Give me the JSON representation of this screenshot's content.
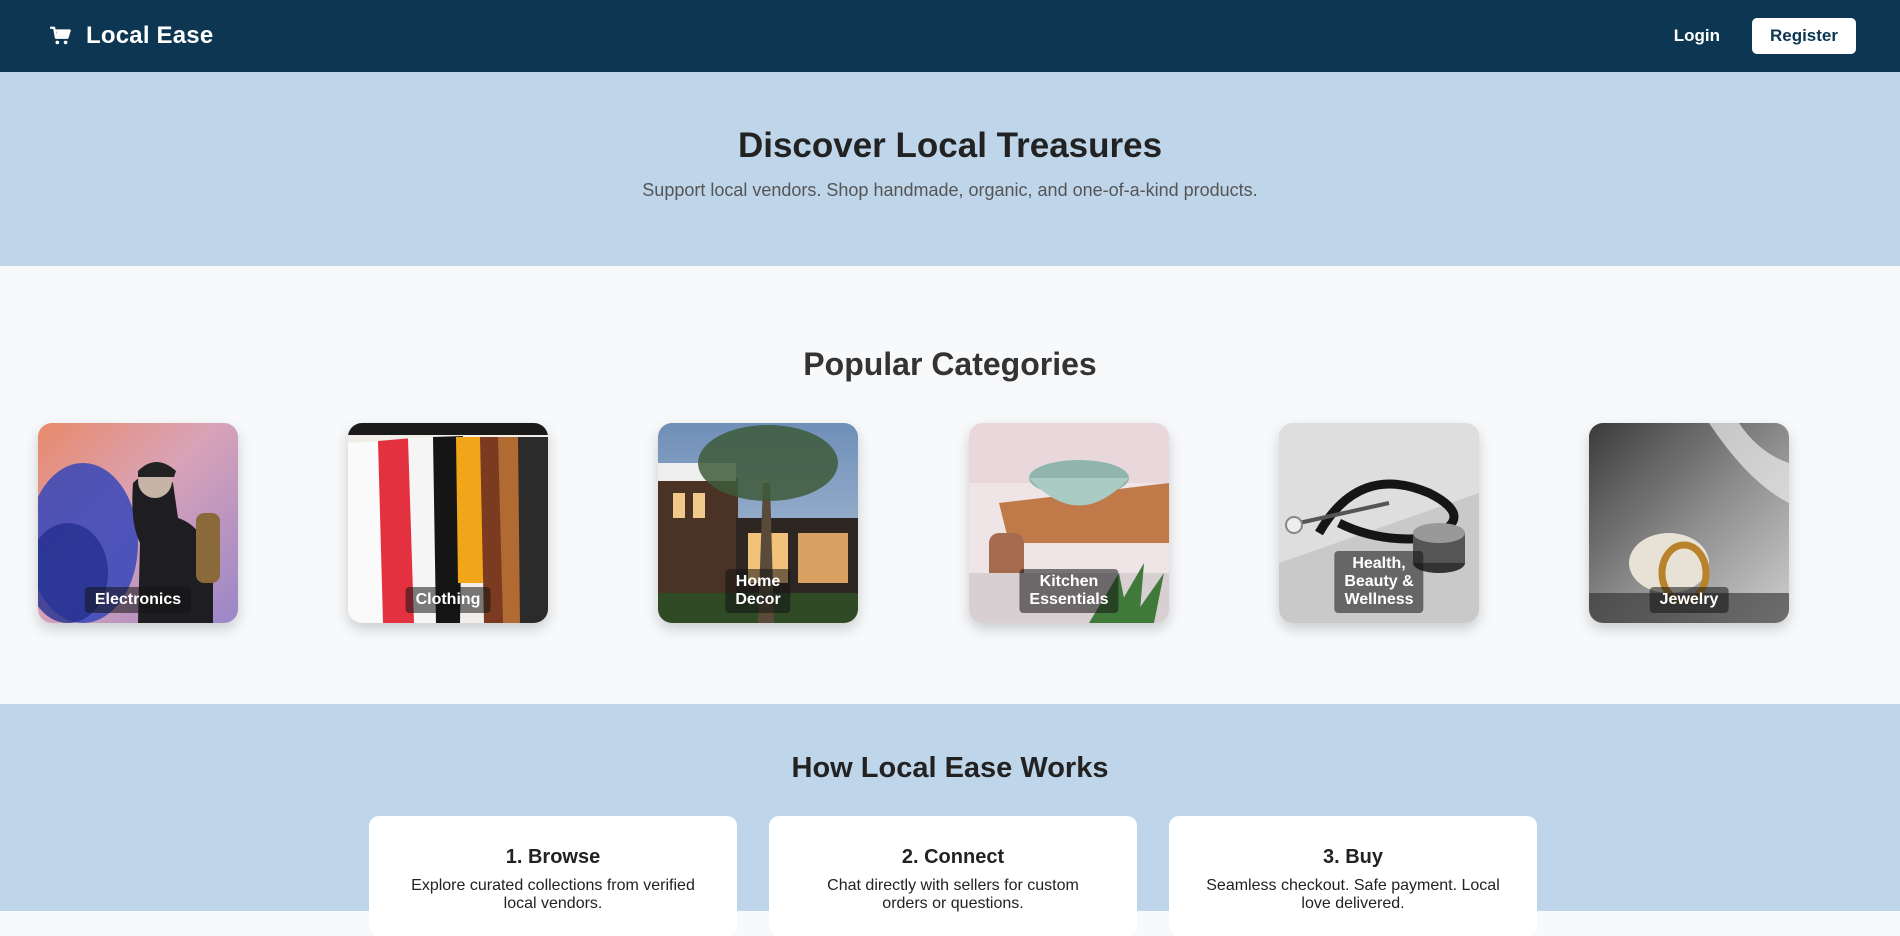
{
  "header": {
    "brand_name": "Local Ease",
    "login_label": "Login",
    "register_label": "Register"
  },
  "hero": {
    "title": "Discover Local Treasures",
    "subtitle": "Support local vendors. Shop handmade, organic, and one-of-a-kind products."
  },
  "categories": {
    "title": "Popular Categories",
    "items": [
      {
        "label": "Electronics"
      },
      {
        "label": "Clothing"
      },
      {
        "label": "Home\nDecor"
      },
      {
        "label": "Kitchen\nEssentials"
      },
      {
        "label": "Health,\nBeauty &\nWellness"
      },
      {
        "label": "Jewelry"
      }
    ]
  },
  "how": {
    "title": "How Local Ease Works",
    "steps": [
      {
        "title": "1. Browse",
        "desc": "Explore curated collections from verified local vendors."
      },
      {
        "title": "2. Connect",
        "desc": "Chat directly with sellers for custom orders or questions."
      },
      {
        "title": "3. Buy",
        "desc": "Seamless checkout. Safe payment. Local love delivered."
      }
    ]
  },
  "colors": {
    "header_bg": "#0c3651",
    "hero_bg": "#bfd6ea",
    "page_bg": "#f7f9fb"
  }
}
